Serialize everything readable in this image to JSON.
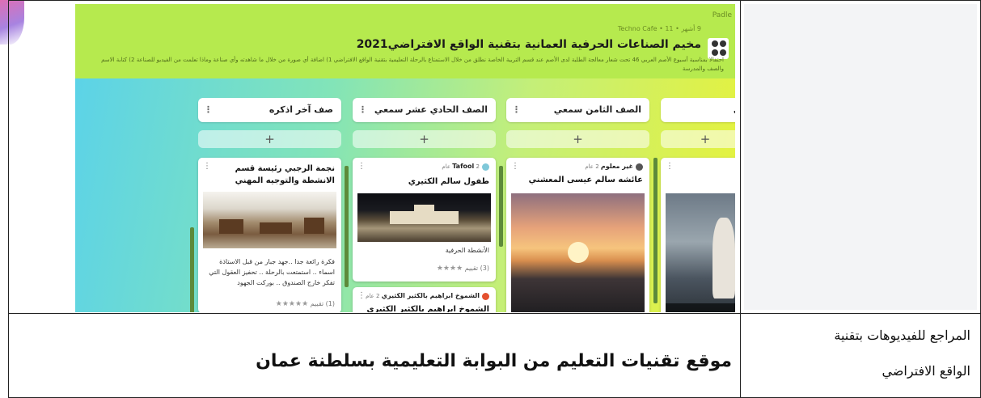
{
  "padlet": {
    "brand": "Padle",
    "meta": "9 أشهر • 11 • Techno Cafe",
    "title": "مخيم الصناعات الحرفية العمانية بتقنية الواقع الافتراضي2021",
    "description": "احتفالا بمناسبة أسبوع الأصم العربي 46 تحت شعار معالجة الطلبة لدى الأصم عند قسم التربية الخاصة نطلق من خلال الاستمتاع بالرحلة التعليمية بتقنية الواقع الافتراضي 1) اضافة أي صورة من خلال ما شاهدته وأي صناعة وماذا تعلمت من الفيديو للصناعة 2) كتابة الاسم والصف والمدرسة",
    "add_symbol": "+",
    "more_symbol": "⋮",
    "columns": [
      {
        "label": "صف آخر اذكره"
      },
      {
        "label": "الصف الحادي عشر سمعي"
      },
      {
        "label": "الصف الثامن سمعي"
      },
      {
        "label": "ي"
      }
    ],
    "cards": {
      "c1": {
        "title": "نجمة الرجبي رئيسة قسم الانشطة والتوجيه المهني",
        "text": "فكرة رائعة جدا ..جهد جبار من قبل الاستاذة اسماء .. استمتعت بالرحلة .. تحفيز العقول التي تفكر خارج الصندوق .. بوركت الجهود",
        "rating_count": "(1) تقييم",
        "stars": "★★★★★"
      },
      "c2": {
        "author": "Tafool",
        "age": "2 عام",
        "title": "طفول سالم الكثيري",
        "text": "الأنشطة الحرفية",
        "rating_count": "(3) تقييم",
        "stars": "★★★★"
      },
      "c2b": {
        "author": "الشموخ ابراهيم بالكثير الكثيري",
        "age": "2 عام",
        "title": "الشموخ ابراهيم بالكثير الكثيري"
      },
      "c3": {
        "author": "غير معلوم",
        "age": "2 عام",
        "title": "عائشه سالم عيسى المعشني"
      }
    }
  },
  "bottom": {
    "title": "موقع تقنيات التعليم من البوابة التعليمية بسلطنة عمان",
    "side_label_line1": "المراجع للفيديوهات بتقنية",
    "side_label_line2": "الواقع الافتراضي"
  },
  "colors": {
    "header_green": "#b6ea4e",
    "gradient_start": "#5ad2ea",
    "gradient_end": "#e7f23a"
  }
}
